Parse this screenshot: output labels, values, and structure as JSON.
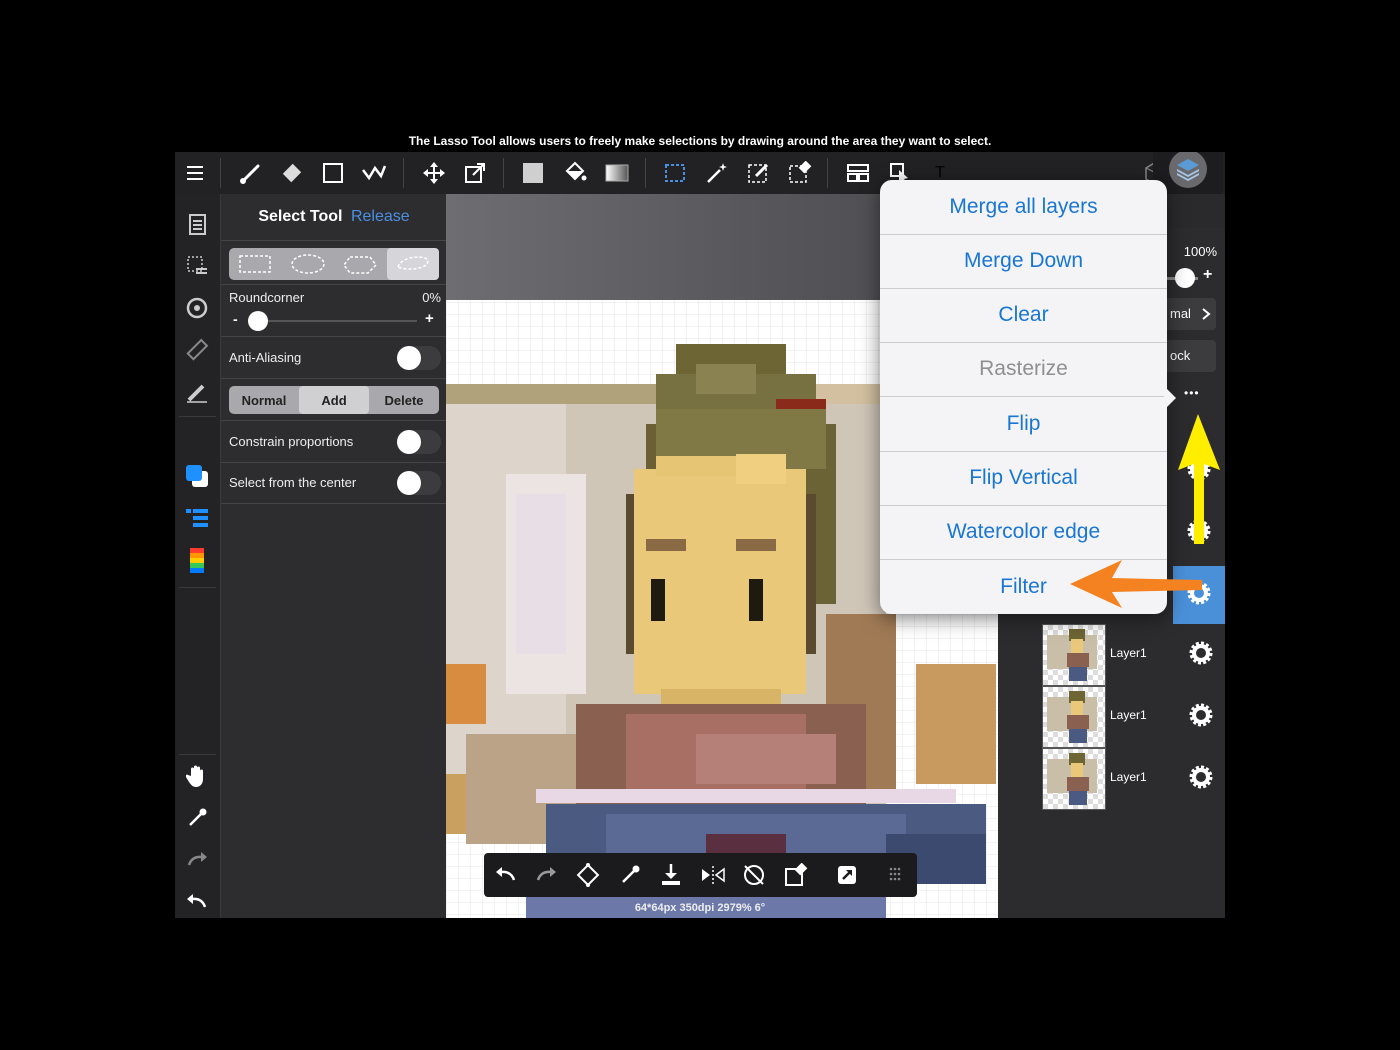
{
  "caption": "The Lasso Tool allows users to freely make selections by drawing around the area they want to select.",
  "select_tool": {
    "title": "Select Tool",
    "release": "Release",
    "roundcorner_label": "Roundcorner",
    "roundcorner_value": "0%",
    "minus": "-",
    "plus": "+",
    "anti_aliasing": "Anti-Aliasing",
    "modes": [
      "Normal",
      "Add",
      "Delete"
    ],
    "active_mode": "Add",
    "constrain": "Constrain proportions",
    "from_center": "Select from the center"
  },
  "layer_panel": {
    "opacity": "100%",
    "plus": "+",
    "blend_partial": "mal",
    "lock_partial": "ock",
    "more": "•••",
    "layers": [
      "Layer1",
      "Layer1",
      "Layer1"
    ]
  },
  "context_menu": {
    "items": [
      "Merge all layers",
      "Merge Down",
      "Clear",
      "Rasterize",
      "Flip",
      "Flip Vertical",
      "Watercolor edge",
      "Filter"
    ],
    "disabled": "Rasterize"
  },
  "status_bar": "64*64px 350dpi 2979% 6°",
  "text_tool_glyph": "T",
  "colors": {
    "accent": "#1976d2",
    "arrow_yellow": "#ffee00",
    "arrow_orange": "#f58220",
    "app_bg": "#2e2e30"
  }
}
